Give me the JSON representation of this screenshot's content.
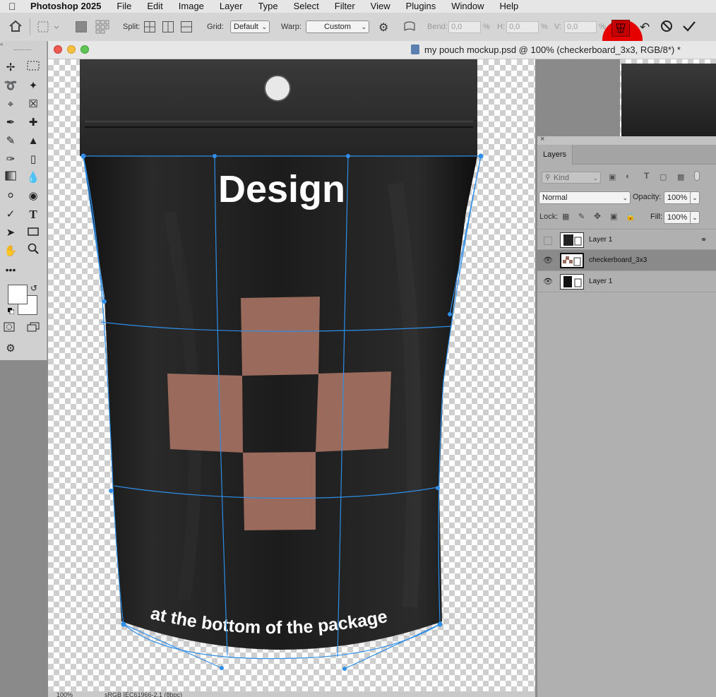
{
  "menubar": {
    "app": "Photoshop 2025",
    "items": [
      "File",
      "Edit",
      "Image",
      "Layer",
      "Type",
      "Select",
      "Filter",
      "View",
      "Plugins",
      "Window",
      "Help"
    ]
  },
  "options": {
    "split_label": "Split:",
    "grid_label": "Grid:",
    "grid_value": "Default",
    "warp_label": "Warp:",
    "warp_value": "Custom",
    "bend_label": "Bend:",
    "bend_value": "0,0",
    "h_label": "H:",
    "h_value": "0,0",
    "v_label": "V:",
    "v_value": "0,0",
    "percent": "%"
  },
  "document": {
    "title": "my pouch mockup.psd @ 100% (checkerboard_3x3, RGB/8*) *",
    "status_zoom": "100%",
    "status_profile": "sRGB IEC61966-2.1 (8bpc)"
  },
  "artwork": {
    "headline": "Design",
    "curved_text": "at the bottom of the package"
  },
  "layers_panel": {
    "tab": "Layers",
    "filter_kind": "Kind",
    "blend_mode": "Normal",
    "opacity_label": "Opacity:",
    "opacity_value": "100%",
    "lock_label": "Lock:",
    "fill_label": "Fill:",
    "fill_value": "100%",
    "layers": [
      {
        "name": "Layer 1",
        "visible": false,
        "selected": false
      },
      {
        "name": "checkerboard_3x3",
        "visible": true,
        "selected": true
      },
      {
        "name": "Layer 1",
        "visible": true,
        "selected": false
      }
    ]
  },
  "colors": {
    "accent_blue": "#2e8ee8",
    "pouch": "#1a1a1a",
    "tile": "#9a6a5c",
    "highlight_red": "#e60000"
  }
}
